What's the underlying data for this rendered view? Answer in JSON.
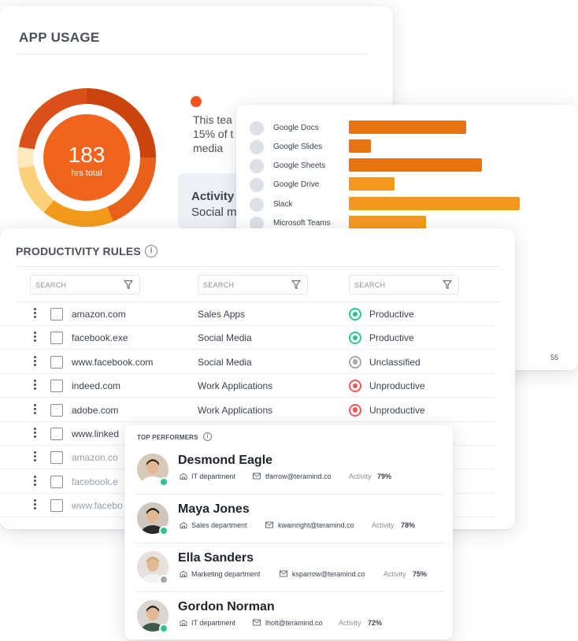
{
  "app_usage": {
    "title": "APP USAGE",
    "total_hours": "183",
    "total_label": "hrs total",
    "legend_color": "#f0561a",
    "description": "This tea\n15% of t\nmedia",
    "activity_box": {
      "line1": "Activity",
      "line2": "Social m"
    },
    "donut_colors": [
      "#c9440f",
      "#e8611a",
      "#f39a1c",
      "#fbd07a",
      "#fde9be"
    ]
  },
  "app_bars": {
    "items": [
      {
        "label": "Google Docs",
        "value": 0.59,
        "color": "#e8750f"
      },
      {
        "label": "Google Slides",
        "value": 0.11,
        "color": "#e8750f"
      },
      {
        "label": "Google Sheets",
        "value": 0.67,
        "color": "#e8750f"
      },
      {
        "label": "Google Drive",
        "value": 0.23,
        "color": "#f39a1c"
      },
      {
        "label": "Slack",
        "value": 0.86,
        "color": "#f39a1c"
      },
      {
        "label": "Microsoft Teams",
        "value": 0.39,
        "color": "#f39a1c"
      }
    ],
    "corner_number": "55"
  },
  "productivity_rules": {
    "title": "PRODUCTIVITY RULES",
    "info_glyph": "i",
    "search_placeholders": [
      "SEARCH",
      "SEARCH",
      "SEARCH"
    ],
    "rows": [
      {
        "domain": "amazon.com",
        "category": "Sales Apps",
        "status": "Productive",
        "status_key": "productive"
      },
      {
        "domain": "facebook.exe",
        "category": "Social Media",
        "status": "Productive",
        "status_key": "productive"
      },
      {
        "domain": "www.facebook.com",
        "category": "Social Media",
        "status": "Unclassified",
        "status_key": "unclassified"
      },
      {
        "domain": "indeed.com",
        "category": "Work Applications",
        "status": "Unproductive",
        "status_key": "unproductive"
      },
      {
        "domain": "adobe.com",
        "category": "Work Applications",
        "status": "Unproductive",
        "status_key": "unproductive"
      },
      {
        "domain": "www.linked",
        "category": "",
        "status": "",
        "status_key": ""
      },
      {
        "domain": "amazon.co",
        "category": "",
        "status": "",
        "status_key": ""
      },
      {
        "domain": "facebook.e",
        "category": "",
        "status": "",
        "status_key": ""
      },
      {
        "domain": "www.facebo",
        "category": "",
        "status": "",
        "status_key": ""
      }
    ]
  },
  "top_performers": {
    "title": "TOP PERFORMERS",
    "info_glyph": "i",
    "activity_label": "Activity",
    "people": [
      {
        "name": "Desmond Eagle",
        "department": "IT department",
        "email": "tfarrow@teramind.co",
        "activity": "79%",
        "presence_color": "#2fc48d",
        "avatar_bg": "#d8c9b8",
        "shirt": "#ffffff",
        "hair": "#3a2a1e"
      },
      {
        "name": "Maya Jones",
        "department": "Sales department",
        "email": "kwainright@teramind.co",
        "activity": "78%",
        "presence_color": "#2fc48d",
        "avatar_bg": "#cfc6bd",
        "shirt": "#2a2a2e",
        "hair": "#1e1815"
      },
      {
        "name": "Ella Sanders",
        "department": "Marketing department",
        "email": "ksparrow@teramind.co",
        "activity": "75%",
        "presence_color": "#a3a8b1",
        "avatar_bg": "#e6e1dc",
        "shirt": "#f3f3f3",
        "hair": "#c9a66b"
      },
      {
        "name": "Gordon Norman",
        "department": "IT department",
        "email": "lholt@teramind.co",
        "activity": "72%",
        "presence_color": "#2fc48d",
        "avatar_bg": "#dcd6d0",
        "shirt": "#3f5a4a",
        "hair": "#2a2420"
      }
    ]
  }
}
